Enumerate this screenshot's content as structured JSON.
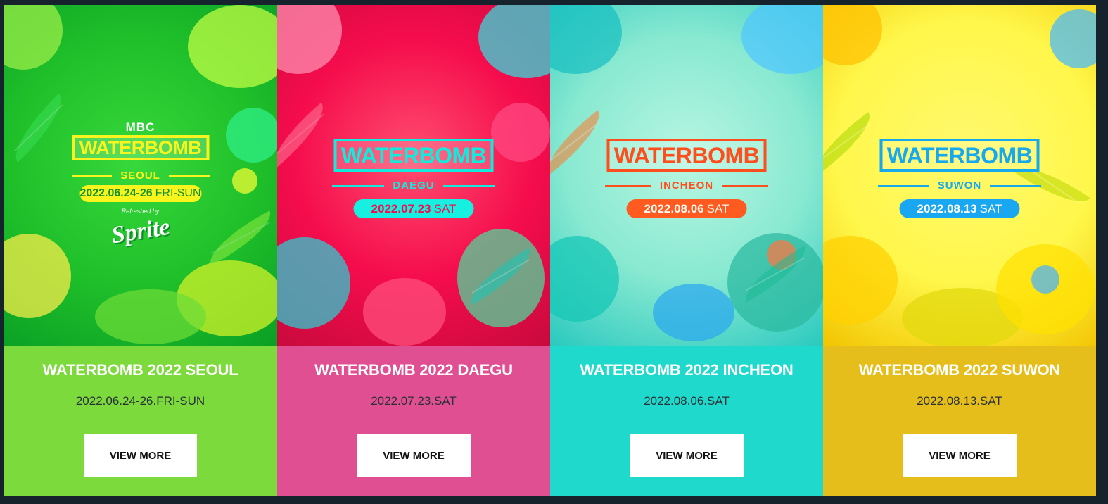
{
  "cards": [
    {
      "poster": {
        "brand": "MBC",
        "logo": "WATERBOMB",
        "city": "SEOUL",
        "date": "2022.06.24-26",
        "day": "FRI-SUN",
        "sponsor_text": "Refreshed by",
        "sponsor_logo": "Sprite"
      },
      "title": "WATERBOMB 2022 SEOUL",
      "date": "2022.06.24-26.FRI-SUN",
      "button": "VIEW MORE",
      "colors": {
        "poster": "#1fbf2a",
        "panel": "#7cda3d"
      }
    },
    {
      "poster": {
        "logo": "WATERBOMB",
        "city": "DAEGU",
        "date": "2022.07.23",
        "day": "SAT"
      },
      "title": "WATERBOMB 2022 DAEGU",
      "date": "2022.07.23.SAT",
      "button": "VIEW MORE",
      "colors": {
        "poster": "#f50c4c",
        "panel": "#df4f91"
      }
    },
    {
      "poster": {
        "logo": "WATERBOMB",
        "city": "INCHEON",
        "date": "2022.08.06",
        "day": "SAT"
      },
      "title": "WATERBOMB 2022 INCHEON",
      "date": "2022.08.06.SAT",
      "button": "VIEW MORE",
      "colors": {
        "poster": "#89e9d1",
        "panel": "#1ed9cc"
      }
    },
    {
      "poster": {
        "logo": "WATERBOMB",
        "city": "SUWON",
        "date": "2022.08.13",
        "day": "SAT"
      },
      "title": "WATERBOMB 2022 SUWON",
      "date": "2022.08.13.SAT",
      "button": "VIEW MORE",
      "colors": {
        "poster": "#fff74b",
        "panel": "#e5be1c"
      }
    }
  ]
}
